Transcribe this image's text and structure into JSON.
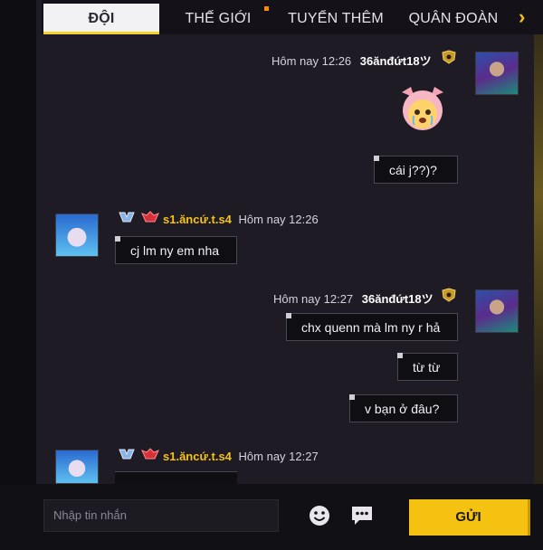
{
  "tabs": [
    {
      "label": "ĐỘI",
      "active": true
    },
    {
      "label": "THẾ GIỚI",
      "active": false
    },
    {
      "label": "TUYỂN THÊM",
      "active": false
    },
    {
      "label": "QUÂN ĐOÀN",
      "active": false
    }
  ],
  "messages": [
    {
      "side": "right",
      "time": "Hôm nay 12:26",
      "name": "36ănđứt18ツ",
      "content": [
        "sticker"
      ]
    },
    {
      "side": "right",
      "content": [
        "cái j??)?"
      ]
    },
    {
      "side": "left",
      "name": "s1.ăncứ.t.s4",
      "time": "Hôm nay 12:26",
      "content": [
        "cj lm ny em nha"
      ]
    },
    {
      "side": "right",
      "time": "Hôm nay 12:27",
      "name": "36ănđứt18ツ",
      "content": [
        "chx quenn mà lm ny r hả",
        "từ từ",
        "v bạn ở đâu?"
      ]
    },
    {
      "side": "left",
      "name": "s1.ăncứ.t.s4",
      "time": "Hôm nay 12:27",
      "content": []
    }
  ],
  "composer": {
    "placeholder": "Nhập tin nhắn",
    "send_label": "GỬI"
  },
  "colors": {
    "accent": "#f5c211",
    "bubble_bg": "#0f0e13",
    "panel_bg": "#1e1b24"
  }
}
